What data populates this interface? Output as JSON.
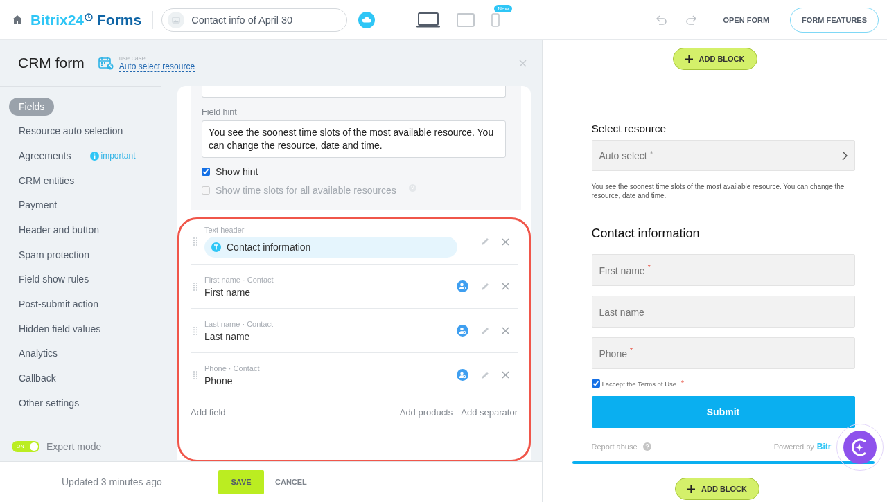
{
  "header": {
    "logo": {
      "brand": "Bitrix24",
      "product": "Forms"
    },
    "form_name": "Contact info of April 30",
    "devices": [
      {
        "kind": "desktop",
        "selected": true
      },
      {
        "kind": "tablet",
        "selected": false
      },
      {
        "kind": "mobile",
        "selected": false,
        "badge": "New"
      }
    ],
    "open_form": "OPEN FORM",
    "features": "FORM FEATURES"
  },
  "editor": {
    "title": "CRM form",
    "use_case_label": "use case",
    "use_case": "Auto select resource",
    "sidebar": {
      "items": [
        {
          "label": "Fields",
          "selected": true
        },
        {
          "label": "Resource auto selection",
          "selected": false
        },
        {
          "label": "Agreements",
          "selected": false,
          "badge": "important"
        },
        {
          "label": "CRM entities",
          "selected": false
        },
        {
          "label": "Payment",
          "selected": false
        },
        {
          "label": "Header and button",
          "selected": false
        },
        {
          "label": "Spam protection",
          "selected": false
        },
        {
          "label": "Field show rules",
          "selected": false
        },
        {
          "label": "Post-submit action",
          "selected": false
        },
        {
          "label": "Hidden field values",
          "selected": false
        },
        {
          "label": "Analytics",
          "selected": false
        },
        {
          "label": "Callback",
          "selected": false
        },
        {
          "label": "Other settings",
          "selected": false
        }
      ]
    },
    "expert_mode": {
      "label": "Expert mode",
      "switch_text": "ON",
      "on": true
    },
    "field_settings": {
      "hint_label": "Field hint",
      "hint_value": "You see the soonest time slots of the most available resource. You can change the resource, date and time.",
      "options": [
        {
          "label": "Show hint",
          "checked": true,
          "disabled": false,
          "help": false
        },
        {
          "label": "Show time slots for all available resources",
          "checked": false,
          "disabled": true,
          "help": true
        }
      ]
    },
    "fields": [
      {
        "kind": "header",
        "caption": "Text header",
        "value": "Contact information"
      },
      {
        "kind": "crm",
        "caption": "First name · Contact",
        "value": "First name"
      },
      {
        "kind": "crm",
        "caption": "Last name · Contact",
        "value": "Last name"
      },
      {
        "kind": "crm",
        "caption": "Phone · Contact",
        "value": "Phone"
      }
    ],
    "add_field": "Add field",
    "add_products": "Add products",
    "add_separator": "Add separator",
    "updated": "Updated 3 minutes ago",
    "save": "SAVE",
    "cancel": "CANCEL"
  },
  "preview": {
    "add_block_top": "ADD BLOCK",
    "resource_title": "Select resource",
    "resource_select": "Auto select",
    "resource_mark": "*",
    "hint": "You see the soonest time slots of the most available resource. You can change the resource, date and time.",
    "contact_title": "Contact information",
    "inputs": [
      {
        "placeholder": "First name",
        "mark": "*"
      },
      {
        "placeholder": "Last name"
      },
      {
        "placeholder": "Phone",
        "mark": "*"
      }
    ],
    "consent": {
      "label": "I accept the Terms of Use",
      "mark": "*",
      "checked": true
    },
    "submit": "Submit",
    "report_abuse": "Report abuse",
    "powered_by": "Powered by",
    "powered_brand": "Bitr",
    "add_block_bottom": "ADD BLOCK"
  }
}
